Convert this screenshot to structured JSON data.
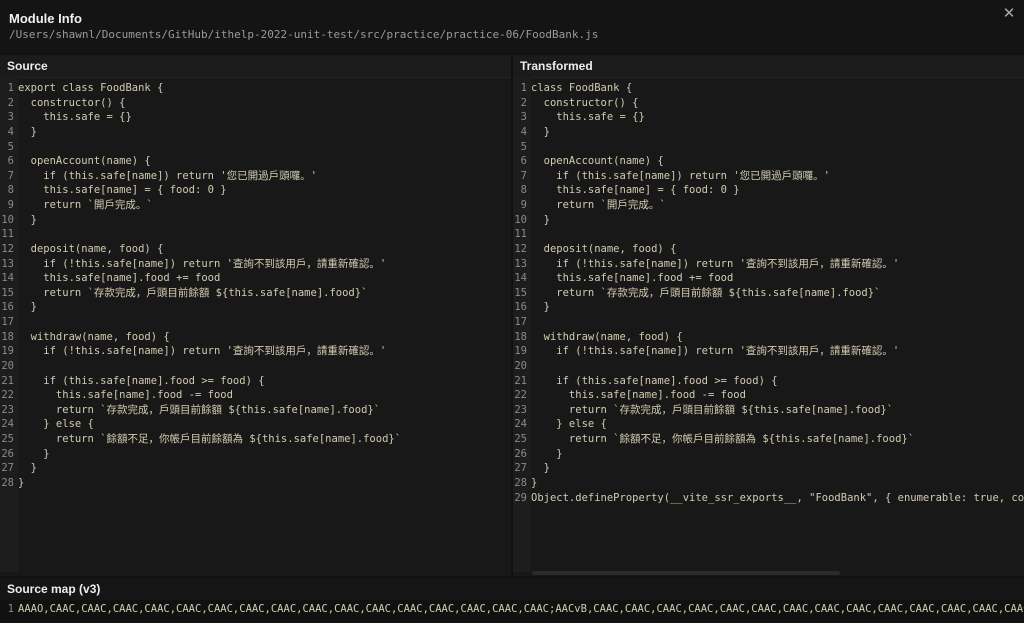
{
  "header": {
    "title": "Module Info",
    "path": "/Users/shawnl/Documents/GitHub/ithelp-2022-unit-test/src/practice/practice-06/FoodBank.js",
    "close_icon": "close-icon"
  },
  "source": {
    "label": "Source",
    "lines": [
      "export class FoodBank {",
      "  constructor() {",
      "    this.safe = {}",
      "  }",
      "",
      "  openAccount(name) {",
      "    if (this.safe[name]) return '您已開過戶頭囉。'",
      "    this.safe[name] = { food: 0 }",
      "    return `開戶完成。`",
      "  }",
      "",
      "  deposit(name, food) {",
      "    if (!this.safe[name]) return '查詢不到該用戶，請重新確認。'",
      "    this.safe[name].food += food",
      "    return `存款完成，戶頭目前餘額 ${this.safe[name].food}`",
      "  }",
      "",
      "  withdraw(name, food) {",
      "    if (!this.safe[name]) return '查詢不到該用戶，請重新確認。'",
      "",
      "    if (this.safe[name].food >= food) {",
      "      this.safe[name].food -= food",
      "      return `存款完成，戶頭目前餘額 ${this.safe[name].food}`",
      "    } else {",
      "      return `餘額不足，你帳戶目前餘額為 ${this.safe[name].food}`",
      "    }",
      "  }",
      "}"
    ]
  },
  "transformed": {
    "label": "Transformed",
    "lines": [
      "class FoodBank {",
      "  constructor() {",
      "    this.safe = {}",
      "  }",
      "",
      "  openAccount(name) {",
      "    if (this.safe[name]) return '您已開過戶頭囉。'",
      "    this.safe[name] = { food: 0 }",
      "    return `開戶完成。`",
      "  }",
      "",
      "  deposit(name, food) {",
      "    if (!this.safe[name]) return '查詢不到該用戶，請重新確認。'",
      "    this.safe[name].food += food",
      "    return `存款完成，戶頭目前餘額 ${this.safe[name].food}`",
      "  }",
      "",
      "  withdraw(name, food) {",
      "    if (!this.safe[name]) return '查詢不到該用戶，請重新確認。'",
      "",
      "    if (this.safe[name].food >= food) {",
      "      this.safe[name].food -= food",
      "      return `存款完成，戶頭目前餘額 ${this.safe[name].food}`",
      "    } else {",
      "      return `餘額不足，你帳戶目前餘額為 ${this.safe[name].food}`",
      "    }",
      "  }",
      "}",
      "Object.defineProperty(__vite_ssr_exports__, \"FoodBank\", { enumerable: true, con"
    ]
  },
  "source_map": {
    "label": "Source map (v3)",
    "line_number": "1",
    "text": "AAAO,CAAC,CAAC,CAAC,CAAC,CAAC,CAAC,CAAC,CAAC,CAAC,CAAC,CAAC,CAAC,CAAC,CAAC,CAAC,CAAC;AACvB,CAAC,CAAC,CAAC,CAAC,CAAC,CAAC,CAAC,CAAC,CAAC,CAAC,CAAC,CAAC,CAAC,CAAC,CAAC,"
  }
}
